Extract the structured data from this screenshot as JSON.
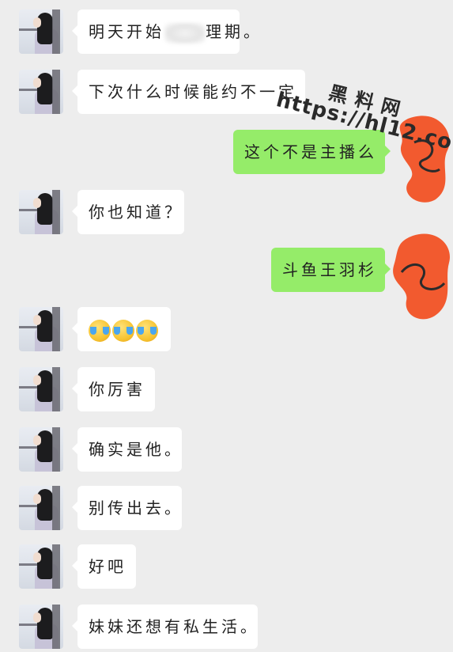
{
  "watermark": {
    "brand": "黑料网",
    "url": "https://hl12.co"
  },
  "colors": {
    "background": "#ededed",
    "incoming_bubble": "#ffffff",
    "outgoing_bubble": "#95ec69",
    "scribble_fill": "#f25a2f"
  },
  "messages": [
    {
      "side": "left",
      "text": "明天开始",
      "redacted": true,
      "text_after": "理期。"
    },
    {
      "side": "left",
      "text": "下次什么时候能约不一定"
    },
    {
      "side": "right",
      "text": "这个不是主播么"
    },
    {
      "side": "left",
      "text": "你也知道？"
    },
    {
      "side": "right",
      "text": "斗鱼王羽杉"
    },
    {
      "side": "left",
      "emoji": [
        "cry-laugh-emoji",
        "cry-laugh-emoji",
        "cry-laugh-emoji"
      ]
    },
    {
      "side": "left",
      "text": "你厉害"
    },
    {
      "side": "left",
      "text": "确实是他。"
    },
    {
      "side": "left",
      "text": "别传出去。"
    },
    {
      "side": "left",
      "text": "好吧"
    },
    {
      "side": "left",
      "text": "妹妹还想有私生活。"
    }
  ]
}
